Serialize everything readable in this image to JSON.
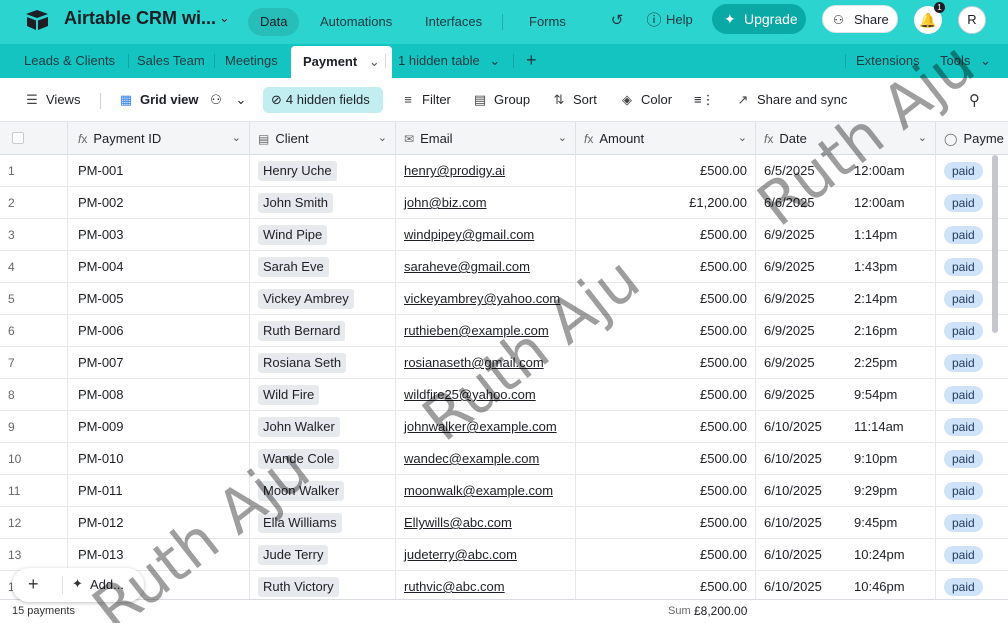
{
  "app": {
    "title": "Airtable CRM wi...",
    "nav": [
      "Data",
      "Automations",
      "Interfaces",
      "Forms"
    ],
    "help": "Help",
    "upgrade": "Upgrade",
    "share": "Share",
    "notifications": "1",
    "avatar": "R",
    "brand_color": "#2cd4d0"
  },
  "tables": {
    "tabs": [
      "Leads & Clients",
      "Sales Team",
      "Meetings",
      "Payment",
      "1 hidden table"
    ],
    "right": [
      "Extensions",
      "Tools"
    ]
  },
  "toolbar": {
    "views": "Views",
    "grid_view": "Grid view",
    "hidden_fields": "4 hidden fields",
    "filter": "Filter",
    "group": "Group",
    "sort": "Sort",
    "color": "Color",
    "share_sync": "Share and sync"
  },
  "columns": [
    "Payment ID",
    "Client",
    "Email",
    "Amount",
    "Date",
    "Payme"
  ],
  "rows": [
    {
      "n": "1",
      "id": "PM-001",
      "client": "Henry Uche",
      "email": "henry@prodigy.ai",
      "amount": "£500.00",
      "date": "6/5/2025",
      "time": "12:00am",
      "status": "paid"
    },
    {
      "n": "2",
      "id": "PM-002",
      "client": "John Smith",
      "email": "john@biz.com",
      "amount": "£1,200.00",
      "date": "6/6/2025",
      "time": "12:00am",
      "status": "paid"
    },
    {
      "n": "3",
      "id": "PM-003",
      "client": "Wind Pipe",
      "email": "windpipey@gmail.com",
      "amount": "£500.00",
      "date": "6/9/2025",
      "time": "1:14pm",
      "status": "paid"
    },
    {
      "n": "4",
      "id": "PM-004",
      "client": "Sarah Eve",
      "email": "saraheve@gmail.com",
      "amount": "£500.00",
      "date": "6/9/2025",
      "time": "1:43pm",
      "status": "paid"
    },
    {
      "n": "5",
      "id": "PM-005",
      "client": "Vickey Ambrey",
      "email": "vickeyambrey@yahoo.com",
      "amount": "£500.00",
      "date": "6/9/2025",
      "time": "2:14pm",
      "status": "paid"
    },
    {
      "n": "6",
      "id": "PM-006",
      "client": "Ruth Bernard",
      "email": "ruthieben@example.com",
      "amount": "£500.00",
      "date": "6/9/2025",
      "time": "2:16pm",
      "status": "paid"
    },
    {
      "n": "7",
      "id": "PM-007",
      "client": "Rosiana Seth",
      "email": "rosianaseth@gmail.com",
      "amount": "£500.00",
      "date": "6/9/2025",
      "time": "2:25pm",
      "status": "paid"
    },
    {
      "n": "8",
      "id": "PM-008",
      "client": "Wild Fire",
      "email": "wildfire25@yahoo.com",
      "amount": "£500.00",
      "date": "6/9/2025",
      "time": "9:54pm",
      "status": "paid"
    },
    {
      "n": "9",
      "id": "PM-009",
      "client": "John Walker",
      "email": "johnwalker@example.com",
      "amount": "£500.00",
      "date": "6/10/2025",
      "time": "11:14am",
      "status": "paid"
    },
    {
      "n": "10",
      "id": "PM-010",
      "client": "Wande Cole",
      "email": "wandec@example.com",
      "amount": "£500.00",
      "date": "6/10/2025",
      "time": "9:10pm",
      "status": "paid"
    },
    {
      "n": "11",
      "id": "PM-011",
      "client": "Moon Walker",
      "email": "moonwalk@example.com",
      "amount": "£500.00",
      "date": "6/10/2025",
      "time": "9:29pm",
      "status": "paid"
    },
    {
      "n": "12",
      "id": "PM-012",
      "client": "Ella Williams",
      "email": "Ellywills@abc.com",
      "amount": "£500.00",
      "date": "6/10/2025",
      "time": "9:45pm",
      "status": "paid"
    },
    {
      "n": "13",
      "id": "PM-013",
      "client": "Jude Terry",
      "email": "judeterry@abc.com",
      "amount": "£500.00",
      "date": "6/10/2025",
      "time": "10:24pm",
      "status": "paid"
    },
    {
      "n": "14",
      "id": "PM-014",
      "client": "Ruth Victory",
      "email": "ruthvic@abc.com",
      "amount": "£500.00",
      "date": "6/10/2025",
      "time": "10:46pm",
      "status": "paid"
    }
  ],
  "footer": {
    "count": "15 payments",
    "sum_label": "Sum",
    "sum_value": "£8,200.00",
    "add_label": "Add..."
  },
  "watermark": "Ruth Aju"
}
